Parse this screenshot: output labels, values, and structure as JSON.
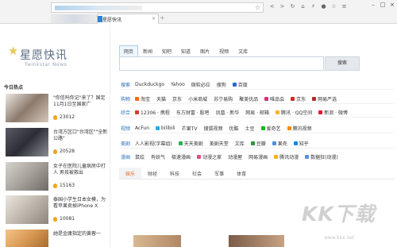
{
  "browser": {
    "tab_title": "星愿快讯",
    "tab_close": "×",
    "tab_new": "+",
    "addr_star": "☆",
    "nav_icons": [
      "<",
      ">",
      "↻",
      "⌂",
      "⚡",
      "●",
      "☆",
      "≡"
    ],
    "window_controls": [
      "–",
      "□",
      "×"
    ]
  },
  "logo": {
    "title": "星愿快讯",
    "subtitle": "Twinkstar News"
  },
  "hot": {
    "label": "今日热点",
    "items": [
      {
        "title": "\"你信吗你记\"来了？国足11月1日至国家广",
        "count": "23012",
        "thumb_color": "#8c7a6c"
      },
      {
        "title": "台湾方区口\"台湾区\"\"全新公路\"",
        "count": "20528",
        "thumb_color": "#2d2d36"
      },
      {
        "title": "女子在医院儿童病房中打人 男孩被救出",
        "count": "15163",
        "thumb_color": "#a6a19b"
      },
      {
        "title": "泰国小学生日本女模，为看苹果卖掉iPhone X",
        "count": "10081",
        "thumb_color": "#bfb7ad"
      },
      {
        "title": "她是金庸指定的黄蓉一",
        "count": "",
        "thumb_color": "#d99a55"
      }
    ]
  },
  "main": {
    "topnav": [
      "网页",
      "新闻",
      "知吧",
      "知道",
      "图片",
      "视频",
      "文库"
    ],
    "search_button": "搜索",
    "rows": [
      {
        "label": "搜索",
        "links": [
          "Duckduckgo",
          "Yahoo",
          "微软必应",
          "搜狗",
          "百度"
        ]
      },
      {
        "label": "购物",
        "links": [
          "淘宝",
          "天猫",
          "京东",
          "小米商城",
          "苏宁易购",
          "聚美优品",
          "唯品会",
          "京东",
          "网易严选"
        ]
      },
      {
        "label": "综合",
        "links": [
          "12306 · 携程",
          "东方财富 · 股吧",
          "凤凰 · 新华",
          "网易 · 邮箱",
          "腾讯 · QQ空间",
          "新浪 · 微博"
        ]
      },
      {
        "label": "视频",
        "links": [
          "AcFun",
          "bilibili",
          "芒果TV",
          "搜狐视频",
          "优酷",
          "土豆",
          "爱奇艺",
          "腾讯视频"
        ]
      },
      {
        "label": "美剧",
        "links": [
          "人人影视(字幕组)",
          "天天美剧",
          "美剧天堂",
          "文库",
          "豆瓣",
          "果壳",
          "知乎"
        ]
      },
      {
        "label": "漫画",
        "links": [
          "鼠绘",
          "有妖气",
          "极速漫画",
          "动漫之家",
          "动漫屋",
          "网易漫画",
          "腾讯动漫",
          "数据狂(动漫)"
        ]
      }
    ],
    "bottom_tabs": [
      "娱乐",
      "财经",
      "科技",
      "社会",
      "军事",
      "体育"
    ]
  },
  "watermark": {
    "text": "KK下载",
    "url": "www.kkx.net"
  }
}
